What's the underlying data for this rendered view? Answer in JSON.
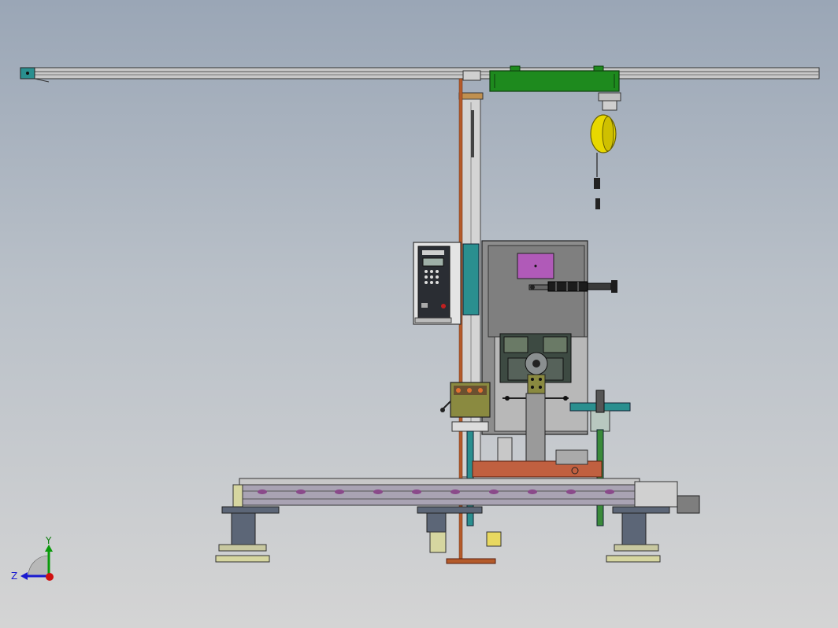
{
  "viewport": {
    "background_top": "#9aa6b6",
    "background_bottom": "#d4d4d4"
  },
  "colors": {
    "cylinder_green": "#1e8a1e",
    "balancer_yellow": "#e8d800",
    "panel_magenta": "#b05ab8",
    "teal": "#2a8f8f",
    "frame_grey": "#8d8d8d",
    "olive_box": "#8a8a40",
    "base_blue_grey": "#5c6677",
    "orange_rust": "#b45a2a"
  },
  "icons": {
    "triad": "xyz-axis-triad-icon"
  },
  "triad": {
    "y_label": "Y",
    "z_label": "Z"
  }
}
